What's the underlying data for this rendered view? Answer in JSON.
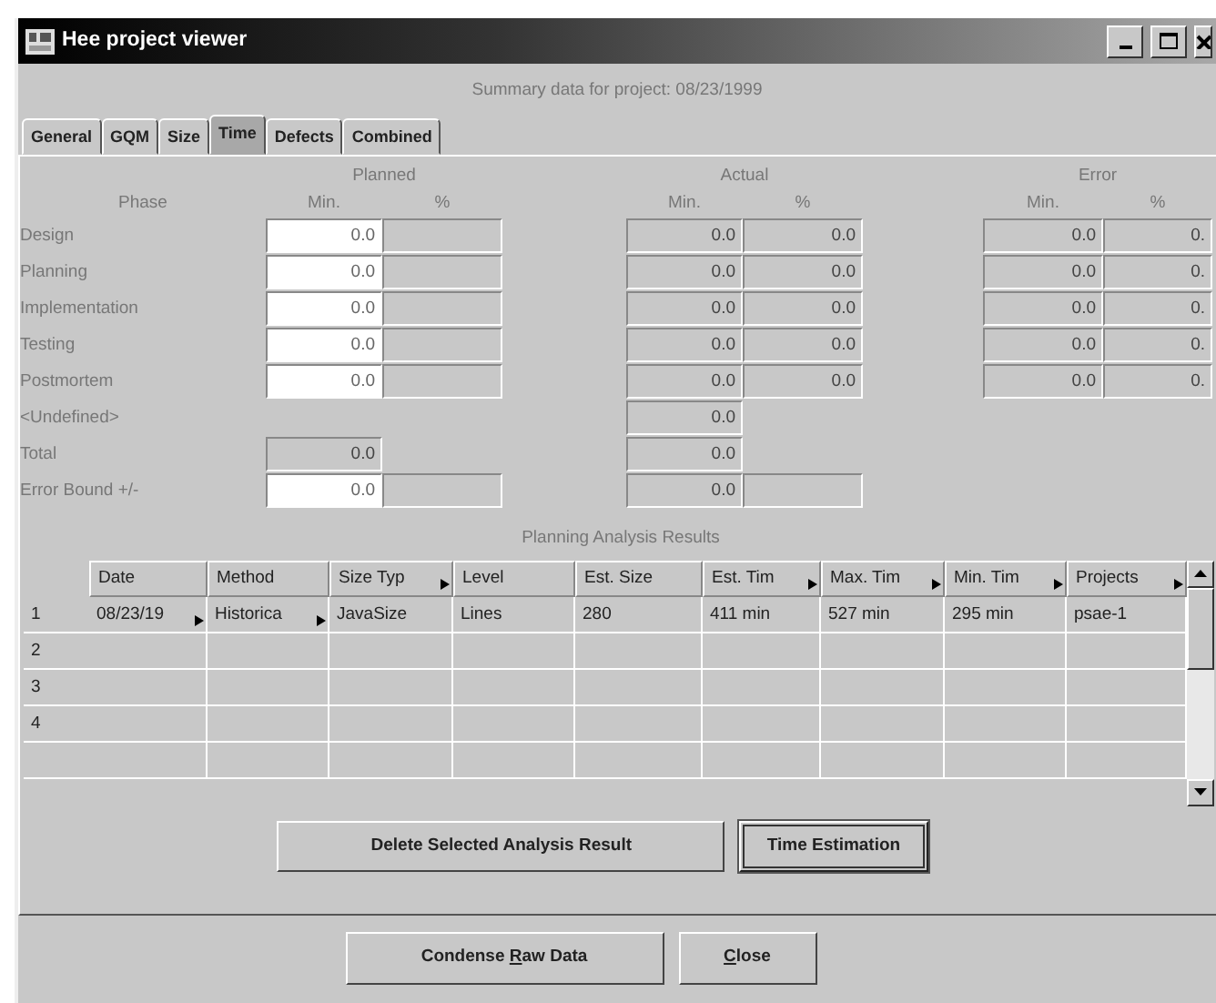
{
  "window": {
    "title": "Hee project viewer"
  },
  "summary": "Summary data for project:  08/23/1999",
  "tabs": [
    {
      "label": "General",
      "selected": false
    },
    {
      "label": "GQM",
      "selected": false
    },
    {
      "label": "Size",
      "selected": false
    },
    {
      "label": "Time",
      "selected": true
    },
    {
      "label": "Defects",
      "selected": false
    },
    {
      "label": "Combined",
      "selected": false
    }
  ],
  "groups": [
    "Planned",
    "Actual",
    "Error"
  ],
  "subheaders": [
    "Phase",
    "Min.",
    "%",
    "Min.",
    "%",
    "Min.",
    "%"
  ],
  "phases": [
    {
      "label": "Design",
      "cells": [
        {
          "text": "0.0",
          "editable": true
        },
        {
          "editable": false
        },
        null,
        {
          "text": "0.0",
          "editable": false
        },
        {
          "text": "0.0",
          "editable": false
        },
        null,
        {
          "text": "0.0",
          "editable": false
        },
        {
          "text": "0.",
          "editable": false
        }
      ]
    },
    {
      "label": "Planning",
      "cells": [
        {
          "text": "0.0",
          "editable": true
        },
        {
          "editable": false
        },
        null,
        {
          "text": "0.0",
          "editable": false
        },
        {
          "text": "0.0",
          "editable": false
        },
        null,
        {
          "text": "0.0",
          "editable": false
        },
        {
          "text": "0.",
          "editable": false
        }
      ]
    },
    {
      "label": "Implementation",
      "cells": [
        {
          "text": "0.0",
          "editable": true
        },
        {
          "editable": false
        },
        null,
        {
          "text": "0.0",
          "editable": false
        },
        {
          "text": "0.0",
          "editable": false
        },
        null,
        {
          "text": "0.0",
          "editable": false
        },
        {
          "text": "0.",
          "editable": false
        }
      ]
    },
    {
      "label": "Testing",
      "cells": [
        {
          "text": "0.0",
          "editable": true
        },
        {
          "editable": false
        },
        null,
        {
          "text": "0.0",
          "editable": false
        },
        {
          "text": "0.0",
          "editable": false
        },
        null,
        {
          "text": "0.0",
          "editable": false
        },
        {
          "text": "0.",
          "editable": false
        }
      ]
    },
    {
      "label": "Postmortem",
      "cells": [
        {
          "text": "0.0",
          "editable": true
        },
        {
          "editable": false
        },
        null,
        {
          "text": "0.0",
          "editable": false
        },
        {
          "text": "0.0",
          "editable": false
        },
        null,
        {
          "text": "0.0",
          "editable": false
        },
        {
          "text": "0.",
          "editable": false
        }
      ]
    },
    {
      "label": "<Undefined>",
      "cells": [
        null,
        null,
        null,
        {
          "text": "0.0",
          "editable": false
        },
        null,
        null,
        null,
        null
      ]
    },
    {
      "label": "Total",
      "cells": [
        {
          "text": "0.0",
          "editable": false
        },
        null,
        null,
        {
          "text": "0.0",
          "editable": false
        },
        null,
        null,
        null,
        null
      ]
    },
    {
      "label": "Error Bound +/-",
      "cells": [
        {
          "text": "0.0",
          "editable": true
        },
        {
          "editable": false
        },
        null,
        {
          "text": "0.0",
          "editable": false
        },
        {
          "editable": false
        },
        null,
        null,
        null
      ]
    }
  ],
  "analysis": {
    "title": "Planning Analysis Results",
    "columns": [
      {
        "label": "Date",
        "truncated": false
      },
      {
        "label": "Method",
        "truncated": false
      },
      {
        "label": "Size Typ",
        "truncated": true
      },
      {
        "label": "Level",
        "truncated": false
      },
      {
        "label": "Est. Size",
        "truncated": false
      },
      {
        "label": "Est. Tim",
        "truncated": true
      },
      {
        "label": "Max. Tim",
        "truncated": true
      },
      {
        "label": "Min. Tim",
        "truncated": true
      },
      {
        "label": "Projects",
        "truncated": true
      }
    ],
    "rows": [
      {
        "number": "1",
        "cells": [
          {
            "text": "08/23/19",
            "truncated": true
          },
          {
            "text": "Historica",
            "truncated": true
          },
          {
            "text": "JavaSize",
            "truncated": false
          },
          {
            "text": "Lines",
            "truncated": false
          },
          {
            "text": "280",
            "truncated": false
          },
          {
            "text": "411 min",
            "truncated": false
          },
          {
            "text": "527 min",
            "truncated": false
          },
          {
            "text": "295 min",
            "truncated": false
          },
          {
            "text": "psae-1",
            "truncated": false
          }
        ]
      },
      {
        "number": "2",
        "cells": []
      },
      {
        "number": "3",
        "cells": []
      },
      {
        "number": "4",
        "cells": []
      }
    ],
    "buttons": [
      {
        "label": "Delete Selected Analysis Result",
        "focused": false
      },
      {
        "label": "Time Estimation",
        "focused": true
      }
    ]
  },
  "buttons": [
    {
      "before": "Condense ",
      "mnemonic": "R",
      "after": "aw Data"
    },
    {
      "mnemonic": "C",
      "after": "lose"
    }
  ]
}
